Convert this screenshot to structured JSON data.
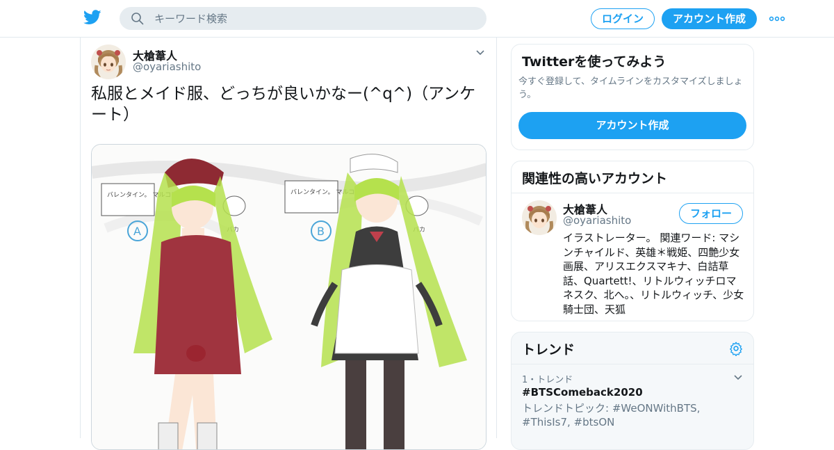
{
  "colors": {
    "accent": "#1da1f2",
    "secondary_text": "#657786",
    "border": "#e1e8ed"
  },
  "topbar": {
    "logo": "twitter-bird-icon",
    "search_placeholder": "キーワード検索",
    "login_label": "ログイン",
    "signup_label": "アカウント作成",
    "more": "more-dots-icon"
  },
  "tweet": {
    "name": "大槍葦人",
    "handle": "@oyariashito",
    "text": "私服とメイド服、どっちが良いかなー(^q^)（アンケート）",
    "media": {
      "labels": [
        "バレンタイン。\nマルコブルーリ",
        "バレンタイン。\nマルコブルーリ",
        "バカ",
        "バカ"
      ]
    }
  },
  "signup_card": {
    "title": "Twitterを使ってみよう",
    "desc": "今すぐ登録して、タイムラインをカスタマイズしましょう。",
    "button": "アカウント作成"
  },
  "related": {
    "title": "関連性の高いアカウント",
    "name": "大槍葦人",
    "handle": "@oyariashito",
    "follow": "フォロー",
    "bio": "イラストレーター。 関連ワード: マシンチャイルド、英雄＊戦姫、四艶少女画展、アリスエクスマキナ、白詰草話、Quartett!、リトルウィッチロマネスク、北へ。、リトルウィッチ、少女騎士団、天狐"
  },
  "trends": {
    "title": "トレンド",
    "items": [
      {
        "meta": "1・トレンド",
        "name": "#BTSComeback2020",
        "topics": "トレンドトピック: #WeONWithBTS, #ThisIs7, #btsON"
      }
    ]
  }
}
